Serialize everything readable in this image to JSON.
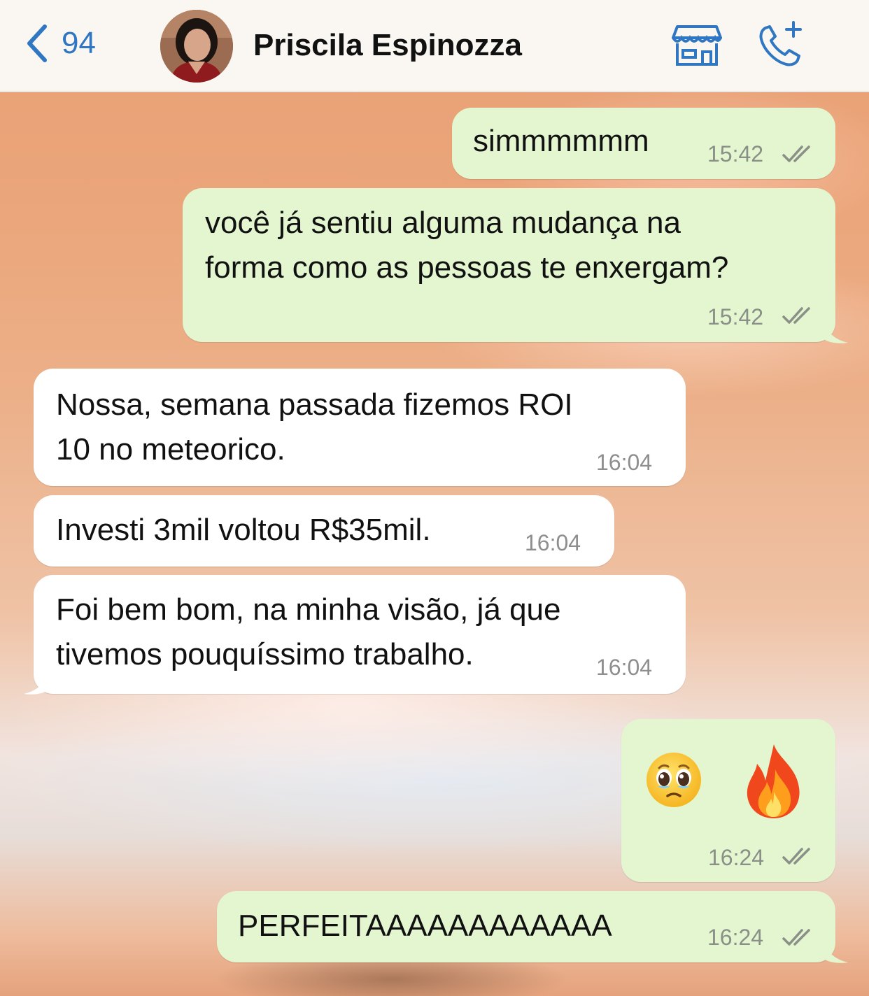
{
  "header": {
    "back_count": "94",
    "contact_name": "Priscila Espinozza"
  },
  "messages": [
    {
      "direction": "outgoing",
      "text": "simmmmmm",
      "time": "15:42",
      "status": "read"
    },
    {
      "direction": "outgoing",
      "text": "você já sentiu alguma mudança na\nforma como as pessoas te enxergam?",
      "time": "15:42",
      "status": "read"
    },
    {
      "direction": "incoming",
      "text": "Nossa, semana passada fizemos ROI\n10 no meteorico.",
      "time": "16:04"
    },
    {
      "direction": "incoming",
      "text": "Investi 3mil voltou R$35mil.",
      "time": "16:04"
    },
    {
      "direction": "incoming",
      "text": "Foi bem bom, na minha visão, já que\ntivemos pouquíssimo trabalho.",
      "time": "16:04"
    },
    {
      "direction": "outgoing",
      "text": "",
      "emojis": [
        "pleading-face",
        "fire"
      ],
      "time": "16:24",
      "status": "read"
    },
    {
      "direction": "outgoing",
      "text": "PERFEITAAAAAAAAAAAA",
      "time": "16:24",
      "status": "read"
    }
  ],
  "colors": {
    "outgoing_bubble": "#e3f6cf",
    "incoming_bubble": "#ffffff",
    "accent": "#2f77c2",
    "read_ticks": "#8a8f88"
  }
}
